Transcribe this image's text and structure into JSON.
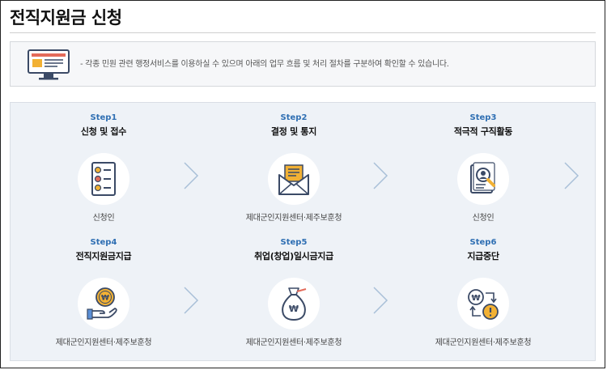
{
  "page": {
    "title": "전직지원금 신청"
  },
  "notice": {
    "icon": "monitor-screen-icon",
    "text": "- 각종 민원 관련 행정서비스를 이용하실 수 있으며 아래의 업무 흐름 및 처리 절차를 구분하여 확인할 수 있습니다."
  },
  "steps": [
    {
      "step": "Step1",
      "title": "신청 및 접수",
      "owner": "신청인",
      "icon": "checklist-document-icon"
    },
    {
      "step": "Step2",
      "title": "결정 및 통지",
      "owner": "제대군인지원센터·제주보훈청",
      "icon": "open-envelope-icon"
    },
    {
      "step": "Step3",
      "title": "적극적 구직활동",
      "owner": "신청인",
      "icon": "resume-magnifier-icon"
    },
    {
      "step": "Step4",
      "title": "전직지원금지급",
      "owner": "제대군인지원센터·제주보훈청",
      "icon": "hand-coin-icon"
    },
    {
      "step": "Step5",
      "title": "취업(창업)일시금지급",
      "owner": "제대군인지원센터·제주보훈청",
      "icon": "money-bag-icon"
    },
    {
      "step": "Step6",
      "title": "지급중단",
      "owner": "제대군인지원센터·제주보훈청",
      "icon": "payment-stop-icon"
    }
  ],
  "colors": {
    "step_number": "#2f6fb3",
    "panel_bg": "#eef2f7",
    "icon_navy": "#3b4a66",
    "icon_gold": "#f2b134",
    "chevron": "#a9c0d8"
  }
}
